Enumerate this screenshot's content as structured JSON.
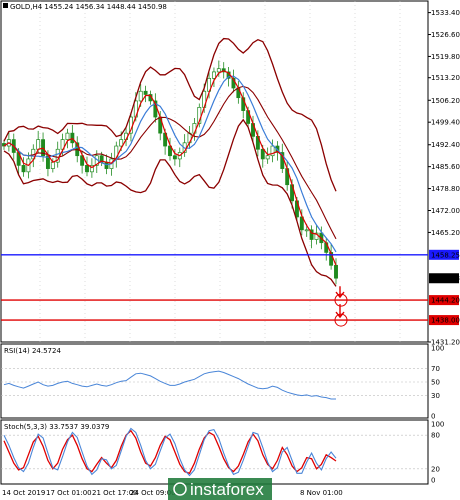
{
  "chart_data": [
    {
      "type": "candlestick",
      "title": "GOLD,H4  1455.24 1456.34 1448.44 1450.98",
      "ylim": [
        1431.2,
        1537.0
      ],
      "y_ticks": [
        "1533.40",
        "1526.60",
        "1519.80",
        "1513.20",
        "1506.20",
        "1499.40",
        "1492.40",
        "1485.60",
        "1478.80",
        "1472.00",
        "1465.20",
        "1458.25",
        "1450.98",
        "1444.20",
        "1438.00",
        "1431.20"
      ],
      "x_ticks": [
        "14 Oct 2019",
        "17 Oct 01:00",
        "21 Oct 17:00",
        "24 Oct 09:00",
        "8 Nov 01:00"
      ],
      "levels": [
        {
          "label": "1458.25",
          "value": 1458.25,
          "color": "#1a1aff"
        },
        {
          "label": "1444.20",
          "value": 1444.2,
          "color": "#e00000"
        },
        {
          "label": "1438.00",
          "value": 1438.0,
          "color": "#e00000"
        }
      ],
      "current_price": {
        "label": "1450.98",
        "value": 1450.98
      },
      "close_series": [
        1492,
        1494,
        1490,
        1486,
        1484,
        1488,
        1491,
        1494,
        1489,
        1485,
        1487,
        1491,
        1494,
        1496,
        1493,
        1489,
        1486,
        1484,
        1486,
        1489,
        1487,
        1485,
        1488,
        1492,
        1494,
        1496,
        1501,
        1506,
        1509,
        1508,
        1506,
        1501,
        1496,
        1492,
        1489,
        1488,
        1490,
        1493,
        1496,
        1499,
        1504,
        1509,
        1513,
        1515,
        1516,
        1515,
        1513,
        1510,
        1507,
        1503,
        1499,
        1495,
        1491,
        1488,
        1489,
        1492,
        1490,
        1485,
        1480,
        1475,
        1470,
        1466,
        1466,
        1463,
        1465,
        1462,
        1459,
        1455,
        1451
      ],
      "overlays": [
        {
          "name": "red_ma",
          "color": "#e00000"
        },
        {
          "name": "blue_ma",
          "color": "#3b7dd8"
        },
        {
          "name": "bollinger",
          "color": "#8b0000"
        }
      ],
      "annotations": [
        {
          "type": "arrow",
          "color": "#e00000",
          "from": 1450.98,
          "to": 1444.2
        },
        {
          "type": "arrow",
          "color": "#e00000",
          "from": 1444.2,
          "to": 1438.0
        }
      ]
    },
    {
      "type": "line",
      "title": "RSI(14) 24.5724",
      "ylim": [
        0,
        100
      ],
      "y_ticks": [
        "100",
        "70",
        "50",
        "30",
        "0"
      ],
      "values": [
        46,
        48,
        45,
        43,
        41,
        44,
        47,
        50,
        46,
        44,
        45,
        48,
        50,
        51,
        48,
        46,
        44,
        43,
        45,
        47,
        45,
        44,
        46,
        49,
        51,
        52,
        57,
        62,
        63,
        61,
        59,
        55,
        51,
        48,
        45,
        45,
        47,
        50,
        52,
        54,
        58,
        62,
        64,
        65,
        66,
        64,
        61,
        58,
        55,
        51,
        47,
        44,
        41,
        40,
        41,
        44,
        42,
        38,
        35,
        33,
        31,
        30,
        31,
        29,
        30,
        28,
        27,
        25,
        25
      ]
    },
    {
      "type": "line",
      "title": "Stoch(5,3,3) 33.7537 39.0379",
      "ylim": [
        0,
        100
      ],
      "y_ticks": [
        "100",
        "80",
        "20",
        "0"
      ],
      "series": [
        {
          "color": "#e00000",
          "values": [
            70,
            50,
            30,
            18,
            22,
            45,
            68,
            78,
            60,
            35,
            20,
            30,
            55,
            72,
            80,
            62,
            38,
            20,
            15,
            28,
            40,
            30,
            22,
            35,
            60,
            80,
            88,
            75,
            50,
            30,
            25,
            40,
            62,
            78,
            72,
            50,
            28,
            15,
            12,
            30,
            55,
            75,
            85,
            80,
            60,
            38,
            22,
            15,
            25,
            45,
            68,
            82,
            70,
            45,
            28,
            20,
            35,
            58,
            45,
            25,
            15,
            22,
            40,
            38,
            20,
            28,
            45,
            40,
            34
          ]
        },
        {
          "color": "#4a86d8",
          "values": [
            80,
            62,
            40,
            22,
            15,
            30,
            58,
            82,
            75,
            48,
            22,
            18,
            42,
            68,
            85,
            76,
            50,
            25,
            10,
            18,
            38,
            36,
            20,
            26,
            52,
            78,
            92,
            85,
            62,
            35,
            20,
            28,
            52,
            75,
            82,
            65,
            38,
            18,
            8,
            18,
            45,
            72,
            88,
            90,
            74,
            48,
            25,
            10,
            14,
            35,
            60,
            85,
            82,
            58,
            32,
            15,
            22,
            50,
            58,
            35,
            12,
            12,
            32,
            48,
            30,
            18,
            38,
            50,
            39
          ]
        }
      ]
    }
  ],
  "watermark": {
    "text": "instaforex",
    "color": "#1f7a3a"
  }
}
